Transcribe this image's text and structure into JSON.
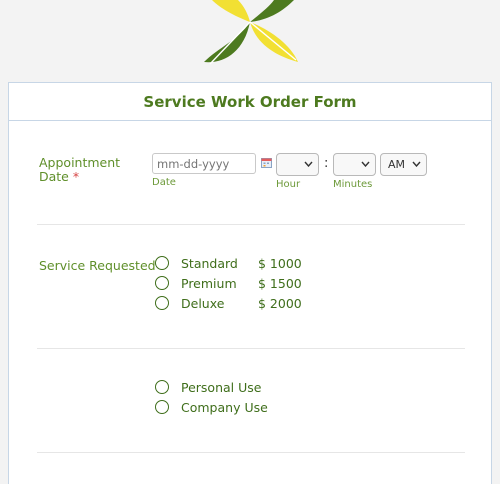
{
  "colors": {
    "accent": "#4d7a1f",
    "leaf_dark": "#4d7a1f",
    "leaf_yellow": "#f2e033",
    "required": "#d64545"
  },
  "form": {
    "title": "Service Work Order Form",
    "appointment": {
      "label_line1": "Appointment",
      "label_line2": "Date",
      "required_mark": "*",
      "date_placeholder": "mm-dd-yyyy",
      "date_sublabel": "Date",
      "hour_sublabel": "Hour",
      "minutes_sublabel": "Minutes",
      "time_separator": ":",
      "ampm_value": "AM",
      "calendar_icon": "calendar-icon"
    },
    "service": {
      "label": "Service Requested",
      "options": [
        {
          "label": "Standard",
          "price": "$ 1000"
        },
        {
          "label": "Premium",
          "price": "$ 1500"
        },
        {
          "label": "Deluxe",
          "price": "$ 2000"
        }
      ]
    },
    "usage": {
      "options": [
        {
          "label": "Personal Use"
        },
        {
          "label": "Company Use"
        }
      ]
    }
  }
}
